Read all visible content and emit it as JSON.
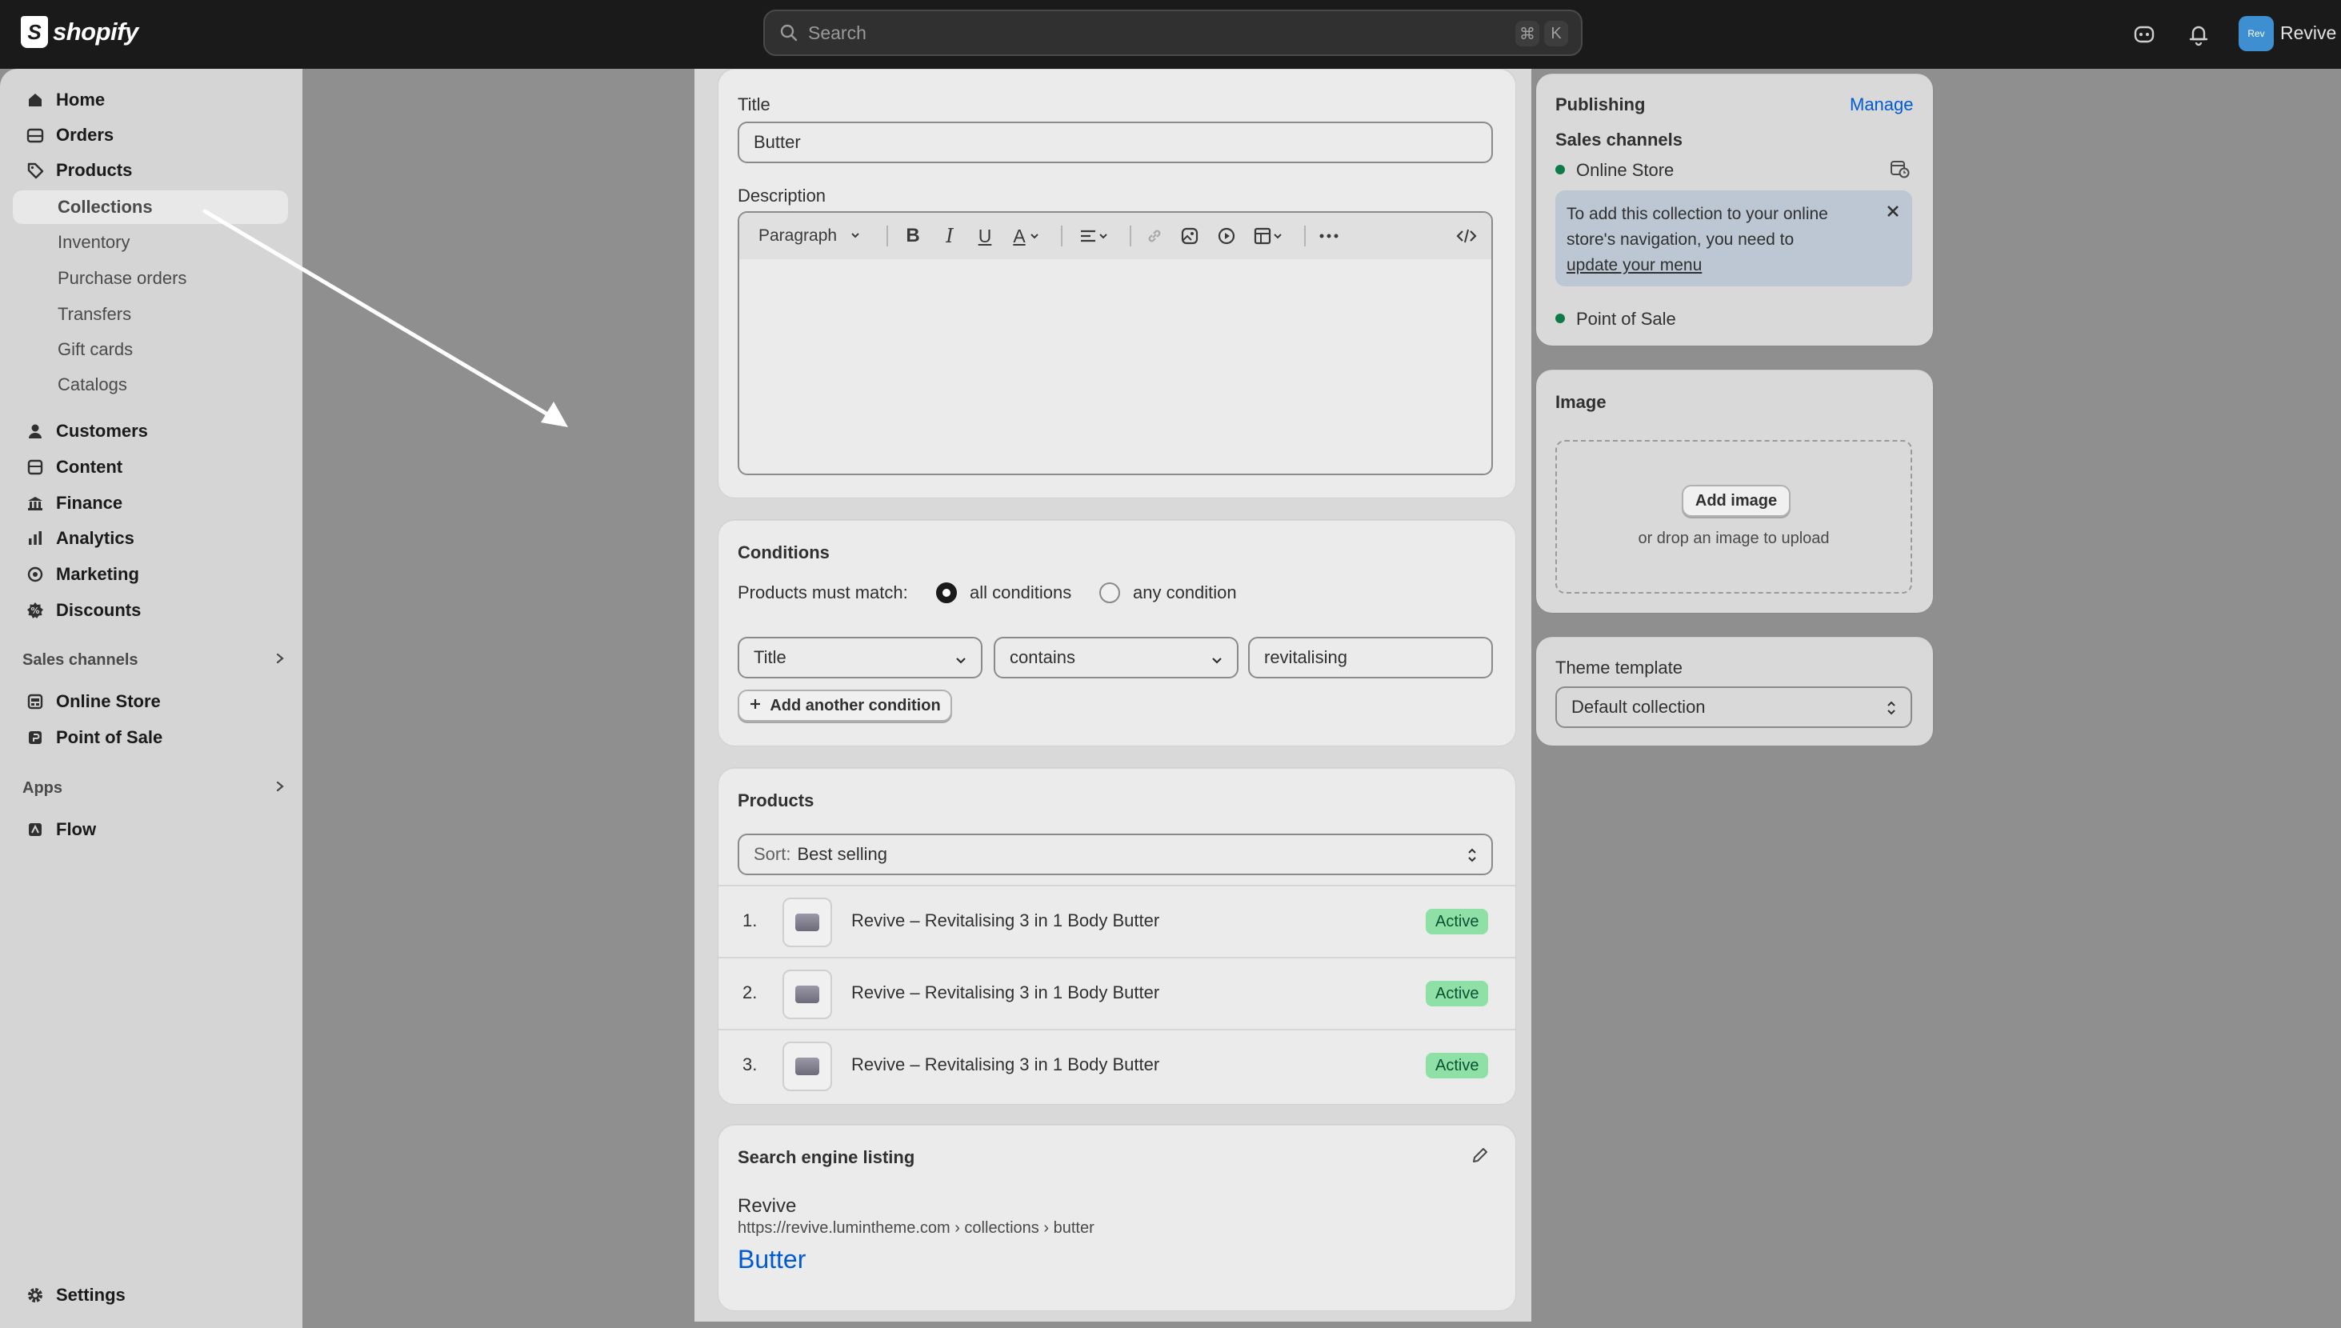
{
  "topbar": {
    "logo_text": "shopify",
    "search_placeholder": "Search",
    "kbd_cmd": "⌘",
    "kbd_k": "K",
    "avatar_initials": "Rev",
    "store_name": "Revive"
  },
  "sidebar": {
    "items": [
      {
        "label": "Home",
        "icon": "home-icon"
      },
      {
        "label": "Orders",
        "icon": "orders-icon"
      },
      {
        "label": "Products",
        "icon": "tag-icon"
      },
      {
        "label": "Collections"
      },
      {
        "label": "Inventory"
      },
      {
        "label": "Purchase orders"
      },
      {
        "label": "Transfers"
      },
      {
        "label": "Gift cards"
      },
      {
        "label": "Catalogs"
      },
      {
        "label": "Customers",
        "icon": "person-icon"
      },
      {
        "label": "Content",
        "icon": "content-icon"
      },
      {
        "label": "Finance",
        "icon": "bank-icon"
      },
      {
        "label": "Analytics",
        "icon": "bar-chart-icon"
      },
      {
        "label": "Marketing",
        "icon": "target-icon"
      },
      {
        "label": "Discounts",
        "icon": "discount-icon"
      }
    ],
    "sales_channels_heading": "Sales channels",
    "channels": [
      {
        "label": "Online Store",
        "icon": "store-icon"
      },
      {
        "label": "Point of Sale",
        "icon": "pos-icon"
      }
    ],
    "apps_heading": "Apps",
    "apps": [
      {
        "label": "Flow",
        "icon": "flow-icon"
      }
    ],
    "settings_label": "Settings"
  },
  "details": {
    "title_label": "Title",
    "title_value": "Butter",
    "description_label": "Description",
    "paragraph_select": "Paragraph"
  },
  "conditions": {
    "heading": "Conditions",
    "match_label": "Products must match:",
    "all_label": "all conditions",
    "any_label": "any condition",
    "field_select": "Title",
    "operator_select": "contains",
    "value": "revitalising",
    "add_button": "Add another condition"
  },
  "products": {
    "heading": "Products",
    "sort_prefix": "Sort:",
    "sort_value": "Best selling",
    "rows": [
      {
        "num": "1.",
        "name": "Revive – Revitalising 3 in 1 Body Butter",
        "status": "Active"
      },
      {
        "num": "2.",
        "name": "Revive – Revitalising 3 in 1 Body Butter",
        "status": "Active"
      },
      {
        "num": "3.",
        "name": "Revive – Revitalising 3 in 1 Body Butter",
        "status": "Active"
      }
    ]
  },
  "seo": {
    "heading": "Search engine listing",
    "site_name": "Revive",
    "url": "https://revive.lumintheme.com › collections › butter",
    "page_title": "Butter"
  },
  "publishing": {
    "heading": "Publishing",
    "manage_link": "Manage",
    "channels_label": "Sales channels",
    "online_store": "Online Store",
    "banner_text": "To add this collection to your online store's navigation, you need to",
    "banner_link": "update your menu",
    "point_of_sale": "Point of Sale"
  },
  "image_card": {
    "heading": "Image",
    "add_button": "Add image",
    "drop_hint": "or drop an image to upload"
  },
  "theme": {
    "label": "Theme template",
    "value": "Default collection"
  },
  "colors": {
    "topbar": "#1a1a1a",
    "badge_active": "#8ee0a6",
    "link": "#005bd3",
    "online_dot": "#0e7a47"
  }
}
